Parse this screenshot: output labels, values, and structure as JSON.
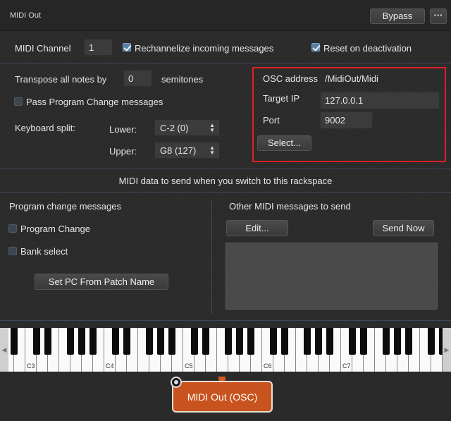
{
  "window": {
    "title": "MIDI Out",
    "bypass_label": "Bypass",
    "more_label": "···"
  },
  "midi": {
    "channel_label": "MIDI Channel",
    "channel_value": "1",
    "rechannelize_label": "Rechannelize incoming messages",
    "rechannelize_checked": true,
    "reset_label": "Reset on deactivation",
    "reset_checked": true
  },
  "transpose": {
    "label": "Transpose all notes by",
    "value": "0",
    "unit": "semitones"
  },
  "pass_pc": {
    "label": "Pass Program Change messages",
    "checked": false
  },
  "keyboard_split": {
    "label": "Keyboard split:",
    "lower_label": "Lower:",
    "lower_value": "C-2 (0)",
    "upper_label": "Upper:",
    "upper_value": "G8 (127)"
  },
  "osc": {
    "address_label": "OSC address",
    "address_value": "/MidiOut/Midi",
    "target_ip_label": "Target IP",
    "target_ip_value": "127.0.0.1",
    "port_label": "Port",
    "port_value": "9002",
    "select_label": "Select...",
    "highlight_color": "#e01e24"
  },
  "rackspace": {
    "header": "MIDI data to send when you switch to this rackspace"
  },
  "program_change": {
    "title": "Program change messages",
    "program_change_label": "Program Change",
    "bank_select_label": "Bank select",
    "set_pc_label": "Set PC From Patch Name"
  },
  "other_midi": {
    "title": "Other MIDI messages to send",
    "edit_label": "Edit...",
    "send_now_label": "Send Now"
  },
  "keyboard": {
    "octave_labels": [
      "C3",
      "C4",
      "C5",
      "C6",
      "C7"
    ]
  },
  "node": {
    "label": "MIDI Out (OSC)",
    "color": "#c8531e"
  },
  "colors": {
    "accent_blue": "#5a7fa0",
    "divider": "#3c4a58"
  }
}
